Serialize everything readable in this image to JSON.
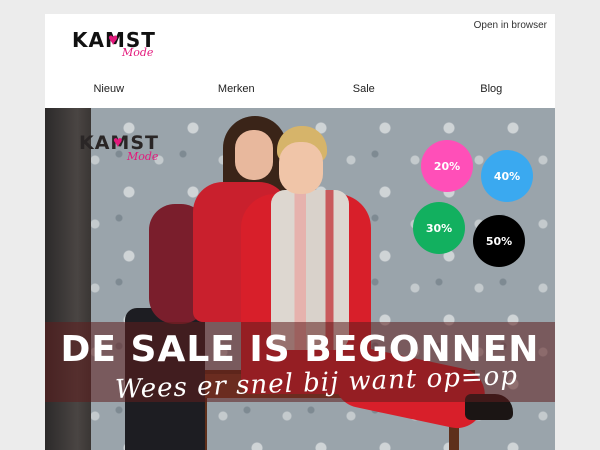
{
  "brand": {
    "logo_text": "KAMST",
    "logo_sub": "Mode",
    "accent_color": "#e3197c"
  },
  "header": {
    "open_in_browser": "Open in browser"
  },
  "nav": {
    "items": [
      {
        "label": "Nieuw"
      },
      {
        "label": "Merken"
      },
      {
        "label": "Sale"
      },
      {
        "label": "Blog"
      }
    ]
  },
  "hero": {
    "badges": [
      {
        "label": "20%",
        "color": "#ff4fb8"
      },
      {
        "label": "40%",
        "color": "#3aa9f0"
      },
      {
        "label": "30%",
        "color": "#12b05f"
      },
      {
        "label": "50%",
        "color": "#000000"
      }
    ],
    "headline": "DE SALE IS BEGONNEN",
    "subline": "Wees er snel bij want op=op"
  }
}
